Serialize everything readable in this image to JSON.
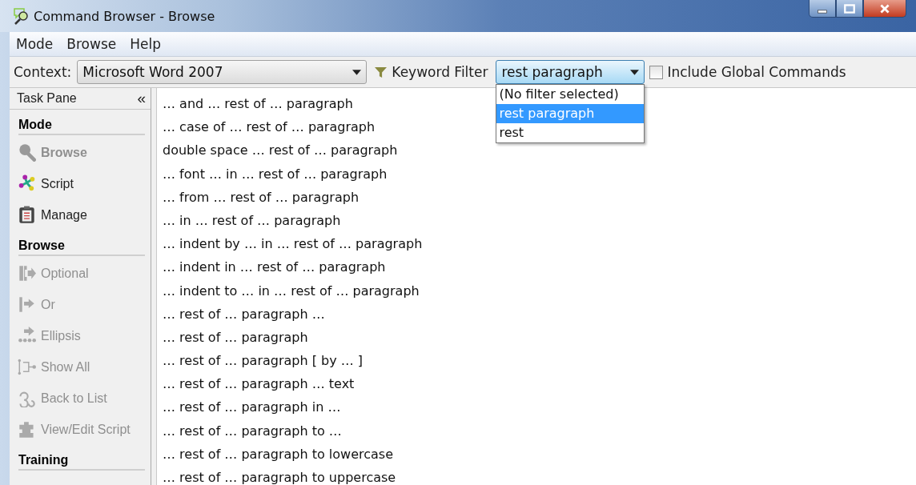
{
  "window": {
    "title": "Command Browser - Browse"
  },
  "menu": [
    {
      "label": "Mode"
    },
    {
      "label": "Browse"
    },
    {
      "label": "Help"
    }
  ],
  "toolbar": {
    "context_label": "Context:",
    "context_value": "Microsoft Word 2007",
    "keyword_label": "Keyword Filter",
    "keyword_value": "rest paragraph",
    "keyword_open": true,
    "keyword_options": [
      {
        "label": "(No filter selected)",
        "selected": false
      },
      {
        "label": "rest paragraph",
        "selected": true
      },
      {
        "label": "rest",
        "selected": false
      }
    ],
    "global": {
      "label": "Include Global Commands",
      "checked": false
    }
  },
  "task_pane": {
    "title": "Task Pane",
    "collapse": "«",
    "sections": [
      {
        "title": "Mode",
        "items": [
          {
            "label": "Browse",
            "disabled": true,
            "bold": true
          },
          {
            "label": "Script",
            "disabled": false,
            "bold": false
          },
          {
            "label": "Manage",
            "disabled": false,
            "bold": false
          }
        ]
      },
      {
        "title": "Browse",
        "items": [
          {
            "label": "Optional",
            "disabled": true,
            "bold": false
          },
          {
            "label": "Or",
            "disabled": true,
            "bold": false
          },
          {
            "label": "Ellipsis",
            "disabled": true,
            "bold": false
          },
          {
            "label": "Show All",
            "disabled": true,
            "bold": false
          },
          {
            "label": "Back to List",
            "disabled": true,
            "bold": false
          },
          {
            "label": "View/Edit Script",
            "disabled": true,
            "bold": false
          }
        ]
      },
      {
        "title": "Training"
      }
    ]
  },
  "commands": [
    "… and … rest of … paragraph",
    "… case of … rest of … paragraph",
    "double space … rest of … paragraph",
    "… font … in … rest of … paragraph",
    "… from … rest of … paragraph",
    "… in … rest of … paragraph",
    "… indent by … in … rest of … paragraph",
    "… indent in … rest of … paragraph",
    "… indent to … in … rest of … paragraph",
    "… rest of … paragraph …",
    "… rest of … paragraph",
    "… rest of … paragraph [ by … ]",
    "… rest of … paragraph … text",
    "… rest of … paragraph in …",
    "… rest of … paragraph to …",
    "… rest of … paragraph to lowercase",
    "… rest of … paragraph to uppercase"
  ]
}
